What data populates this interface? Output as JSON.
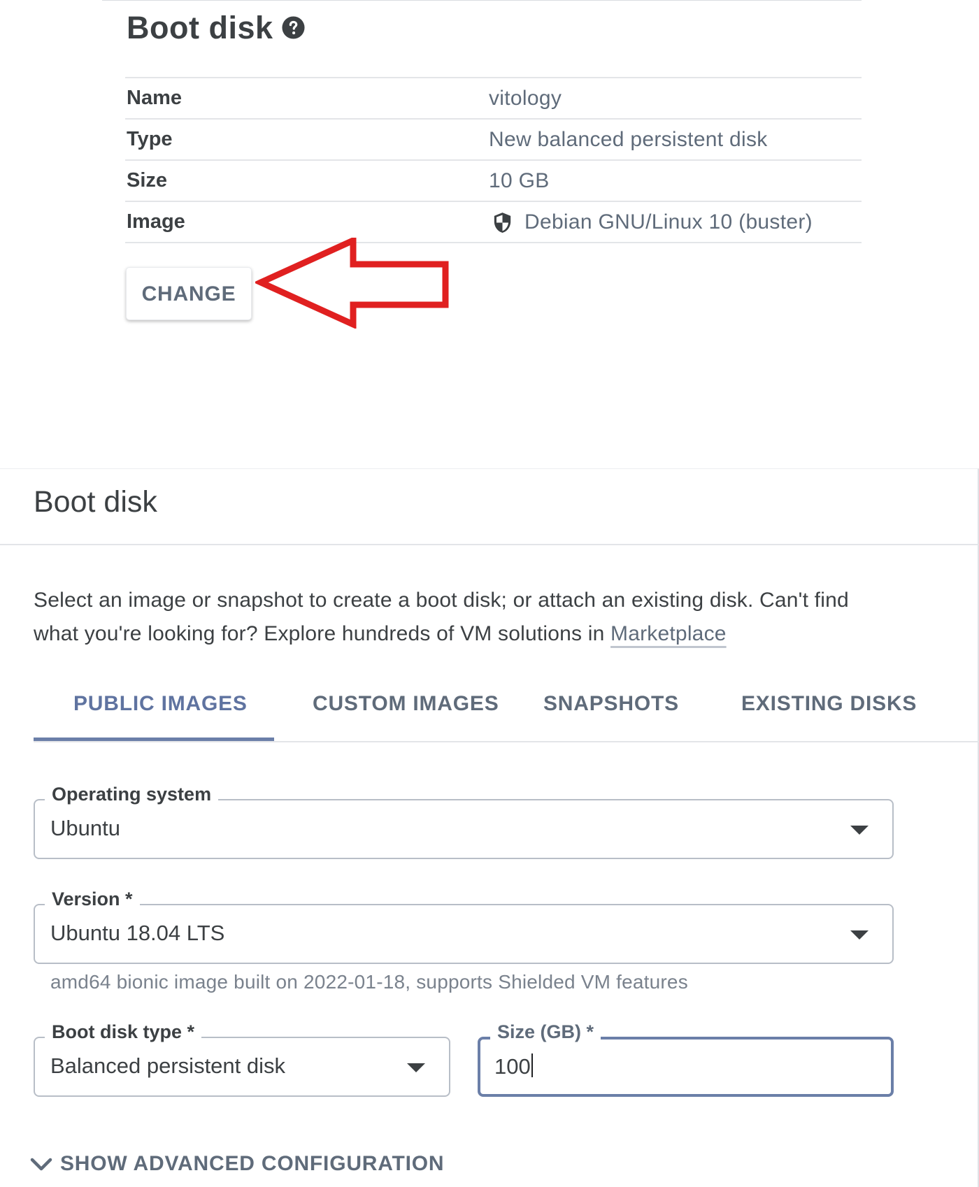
{
  "summary": {
    "title": "Boot disk",
    "rows": [
      {
        "label": "Name",
        "value": "vitology"
      },
      {
        "label": "Type",
        "value": "New balanced persistent disk"
      },
      {
        "label": "Size",
        "value": "10 GB"
      },
      {
        "label": "Image",
        "value": "Debian GNU/Linux 10 (buster)",
        "icon": "shield-icon"
      }
    ],
    "change_label": "CHANGE",
    "annotation_color": "#e02020"
  },
  "dialog": {
    "title": "Boot disk",
    "description_line1": "Select an image or snapshot to create a boot disk; or attach an existing disk. Can't find",
    "description_line2": "what you're looking for? Explore hundreds of VM solutions in ",
    "marketplace_link": "Marketplace",
    "tabs": [
      {
        "label": "PUBLIC IMAGES",
        "active": true
      },
      {
        "label": "CUSTOM IMAGES",
        "active": false
      },
      {
        "label": "SNAPSHOTS",
        "active": false
      },
      {
        "label": "EXISTING DISKS",
        "active": false
      }
    ],
    "operating_system": {
      "label": "Operating system",
      "value": "Ubuntu"
    },
    "version": {
      "label": "Version *",
      "value": "Ubuntu 18.04 LTS",
      "hint": "amd64 bionic image built on 2022-01-18, supports Shielded VM features"
    },
    "boot_disk_type": {
      "label": "Boot disk type *",
      "value": "Balanced persistent disk"
    },
    "size": {
      "label": "Size (GB) *",
      "value": "100"
    },
    "advanced_label": "SHOW ADVANCED CONFIGURATION"
  },
  "colors": {
    "accent": "#6b7fa8",
    "text": "#3c4043",
    "muted": "#5f6b7a",
    "annotation": "#e02020"
  }
}
